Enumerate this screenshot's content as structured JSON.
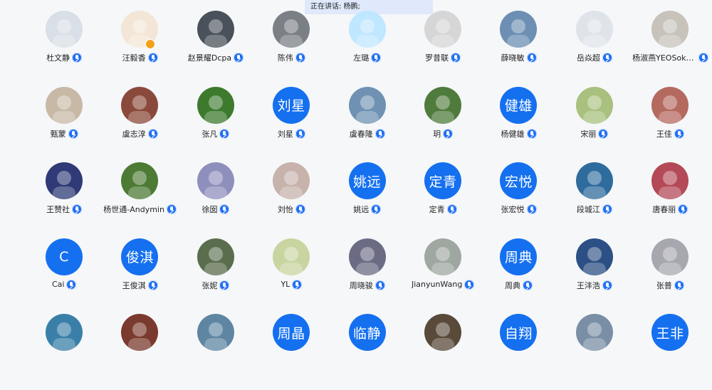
{
  "banner": {
    "speaking_label": "正在讲话: 杨鹏;"
  },
  "participants": [
    {
      "name": "杜文静",
      "avatar_type": "photo",
      "avatar_bg": "#d9dfe6"
    },
    {
      "name": "汪毅香",
      "avatar_type": "photo",
      "avatar_bg": "#f3e6d6",
      "has_lock": true
    },
    {
      "name": "赵景耀Dcpa",
      "avatar_type": "photo",
      "avatar_bg": "#49525a"
    },
    {
      "name": "陈伟",
      "avatar_type": "photo",
      "avatar_bg": "#7b7f86"
    },
    {
      "name": "左璐",
      "avatar_type": "photo",
      "avatar_bg": "#bfe7ff"
    },
    {
      "name": "罗昔联",
      "avatar_type": "photo",
      "avatar_bg": "#d6d6d6"
    },
    {
      "name": "薛晓敏",
      "avatar_type": "photo",
      "avatar_bg": "#6c8fb3"
    },
    {
      "name": "岳焱超",
      "avatar_type": "photo",
      "avatar_bg": "#dfe3ea"
    },
    {
      "name": "杨淑燕YEOSokY...",
      "avatar_type": "photo",
      "avatar_bg": "#c7c3bb"
    },
    {
      "name": "甄蒙",
      "avatar_type": "photo",
      "avatar_bg": "#c8b9a6"
    },
    {
      "name": "虞志淳",
      "avatar_type": "photo",
      "avatar_bg": "#8a4a3b"
    },
    {
      "name": "张凡",
      "avatar_type": "photo",
      "avatar_bg": "#3d7a2d"
    },
    {
      "name": "刘星",
      "avatar_type": "text",
      "avatar_text": "刘星"
    },
    {
      "name": "虞春隆",
      "avatar_type": "photo",
      "avatar_bg": "#6f92b3"
    },
    {
      "name": "玥",
      "avatar_type": "photo",
      "avatar_bg": "#4f7b3d"
    },
    {
      "name": "杨健雄",
      "avatar_type": "text",
      "avatar_text": "健雄"
    },
    {
      "name": "宋丽",
      "avatar_type": "photo",
      "avatar_bg": "#a9c07e"
    },
    {
      "name": "王佳",
      "avatar_type": "photo",
      "avatar_bg": "#b46a5f"
    },
    {
      "name": "王赞社",
      "avatar_type": "photo",
      "avatar_bg": "#2f3a77"
    },
    {
      "name": "杨世通-Andymin",
      "avatar_type": "photo",
      "avatar_bg": "#4d7a34"
    },
    {
      "name": "徐囡",
      "avatar_type": "photo",
      "avatar_bg": "#8f8fbd"
    },
    {
      "name": "刘怡",
      "avatar_type": "photo",
      "avatar_bg": "#c7b2ac"
    },
    {
      "name": "姚远",
      "avatar_type": "text",
      "avatar_text": "姚远"
    },
    {
      "name": "定青",
      "avatar_type": "text",
      "avatar_text": "定青"
    },
    {
      "name": "张宏悦",
      "avatar_type": "text",
      "avatar_text": "宏悦"
    },
    {
      "name": "段城江",
      "avatar_type": "photo",
      "avatar_bg": "#2f6c9e"
    },
    {
      "name": "唐春丽",
      "avatar_type": "photo",
      "avatar_bg": "#b44a57"
    },
    {
      "name": "Cai",
      "avatar_type": "text",
      "avatar_text": "C"
    },
    {
      "name": "王俊淇",
      "avatar_type": "text",
      "avatar_text": "俊淇"
    },
    {
      "name": "张妮",
      "avatar_type": "photo",
      "avatar_bg": "#5a6d4d"
    },
    {
      "name": "YL",
      "avatar_type": "photo",
      "avatar_bg": "#c8d5a1"
    },
    {
      "name": "周晓骏",
      "avatar_type": "photo",
      "avatar_bg": "#6b6b84"
    },
    {
      "name": "JianyunWang",
      "avatar_type": "photo",
      "avatar_bg": "#9ea7a0"
    },
    {
      "name": "周典",
      "avatar_type": "text",
      "avatar_text": "周典"
    },
    {
      "name": "王沣浩",
      "avatar_type": "photo",
      "avatar_bg": "#2c4f85"
    },
    {
      "name": "张普",
      "avatar_type": "photo",
      "avatar_bg": "#a7a7b0"
    },
    {
      "name": "",
      "avatar_type": "photo",
      "avatar_bg": "#3a7fa8"
    },
    {
      "name": "",
      "avatar_type": "photo",
      "avatar_bg": "#7a3a2d"
    },
    {
      "name": "",
      "avatar_type": "photo",
      "avatar_bg": "#5e86a3"
    },
    {
      "name": "",
      "avatar_type": "text",
      "avatar_text": "周晶"
    },
    {
      "name": "",
      "avatar_type": "text",
      "avatar_text": "临静"
    },
    {
      "name": "",
      "avatar_type": "photo",
      "avatar_bg": "#5a4a3a"
    },
    {
      "name": "",
      "avatar_type": "text",
      "avatar_text": "自翔"
    },
    {
      "name": "",
      "avatar_type": "photo",
      "avatar_bg": "#7a8fa6"
    },
    {
      "name": "",
      "avatar_type": "text",
      "avatar_text": "王非"
    }
  ]
}
